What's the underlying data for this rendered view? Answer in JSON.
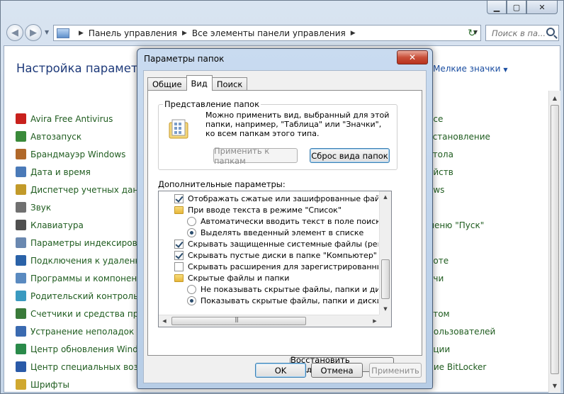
{
  "window": {
    "minimize_glyph": "▁",
    "maximize_glyph": "▢",
    "close_glyph": "✕"
  },
  "nav": {
    "back_glyph": "◀",
    "forward_glyph": "▶",
    "breadcrumbs": [
      "Панель управления",
      "Все элементы панели управления"
    ],
    "refresh_glyph": "↻",
    "search_placeholder": "Поиск в па..."
  },
  "page": {
    "heading": "Настройка параметров компьютера",
    "view_label": "Мелкие значки",
    "view_arrow": "▼"
  },
  "left_items": [
    {
      "label": "Avira Free Antivirus",
      "color": "#c8201c"
    },
    {
      "label": "Автозапуск",
      "color": "#3a8a3a"
    },
    {
      "label": "Брандмауэр Windows",
      "color": "#b0682a"
    },
    {
      "label": "Дата и время",
      "color": "#4a7ab8"
    },
    {
      "label": "Диспетчер учетных данных",
      "color": "#c29a2a"
    },
    {
      "label": "Звук",
      "color": "#707070"
    },
    {
      "label": "Клавиатура",
      "color": "#505050"
    },
    {
      "label": "Параметры индексирования",
      "color": "#6a88b0"
    },
    {
      "label": "Подключения к удаленным",
      "color": "#2a62a8"
    },
    {
      "label": "Программы и компоненты",
      "color": "#5a8ac0"
    },
    {
      "label": "Родительский контроль",
      "color": "#3a9ac0"
    },
    {
      "label": "Счетчики и средства произ",
      "color": "#3a7a3a"
    },
    {
      "label": "Устранение неполадок",
      "color": "#3a6ab0"
    },
    {
      "label": "Центр обновления Window",
      "color": "#2a8a4a"
    },
    {
      "label": "Центр специальных возмож",
      "color": "#2a5aa8"
    },
    {
      "label": "Шрифты",
      "color": "#d0a830"
    }
  ],
  "right_items": [
    {
      "label": "ace",
      "color": "#5a8ac0"
    },
    {
      "label": "сстановление",
      "color": "#3a8a3a"
    },
    {
      "label": "стола",
      "color": "#4a7ab8"
    },
    {
      "label": "ойств",
      "color": "#5a8ac0"
    },
    {
      "label": "ows",
      "color": "#3a7ab0"
    },
    {
      "label": "",
      "color": "#ffffff"
    },
    {
      "label": "меню \"Пуск\"",
      "color": "#3a6ab0"
    },
    {
      "label": "",
      "color": "#ffffff"
    },
    {
      "label": "боте",
      "color": "#3a8a3a"
    },
    {
      "label": "ечи",
      "color": "#5a8ac0"
    },
    {
      "label": "",
      "color": "#ffffff"
    },
    {
      "label": "ятом",
      "color": "#3a7ab0"
    },
    {
      "label": "пользователей",
      "color": "#4a7ab8"
    },
    {
      "label": "ации",
      "color": "#3a8a3a"
    },
    {
      "label": "ние BitLocker",
      "color": "#707070"
    },
    {
      "label": "",
      "color": "#ffffff"
    }
  ],
  "dialog": {
    "title": "Параметры папок",
    "close_glyph": "✕",
    "tabs": [
      "Общие",
      "Вид",
      "Поиск"
    ],
    "group_title": "Представление папок",
    "group_desc": "Можно применить вид, выбранный для этой папки, например, \"Таблица\" или \"Значки\", ко всем папкам этого типа.",
    "apply_to_folders": "Применить к папкам",
    "reset_folders": "Сброс вида папок",
    "advanced_label": "Дополнительные параметры:",
    "tree": [
      {
        "kind": "check",
        "on": true,
        "indent": 1,
        "label": "Отображать сжатые или зашифрованные файлы NTFS"
      },
      {
        "kind": "folder",
        "on": false,
        "indent": 1,
        "label": "При вводе текста в режиме \"Список\""
      },
      {
        "kind": "radio",
        "on": false,
        "indent": 2,
        "label": "Автоматически вводить текст в поле поиска"
      },
      {
        "kind": "radio",
        "on": true,
        "indent": 2,
        "label": "Выделять введенный элемент в списке"
      },
      {
        "kind": "check",
        "on": true,
        "indent": 1,
        "label": "Скрывать защищенные системные файлы (рекомендуется)"
      },
      {
        "kind": "check",
        "on": true,
        "indent": 1,
        "label": "Скрывать пустые диски в папке \"Компьютер\""
      },
      {
        "kind": "check",
        "on": false,
        "indent": 1,
        "label": "Скрывать расширения для зарегистрированных типов файлов"
      },
      {
        "kind": "folder",
        "on": false,
        "indent": 1,
        "label": "Скрытые файлы и папки"
      },
      {
        "kind": "radio",
        "on": false,
        "indent": 2,
        "label": "Не показывать скрытые файлы, папки и диски"
      },
      {
        "kind": "radio",
        "on": true,
        "indent": 2,
        "label": "Показывать скрытые файлы, папки и диски"
      }
    ],
    "restore_defaults": "Восстановить умолчания",
    "ok": "OK",
    "cancel": "Отмена",
    "apply": "Применить",
    "scroll_up_glyph": "▲",
    "scroll_down_glyph": "▼",
    "scroll_left_glyph": "◀",
    "scroll_right_glyph": "▶"
  }
}
